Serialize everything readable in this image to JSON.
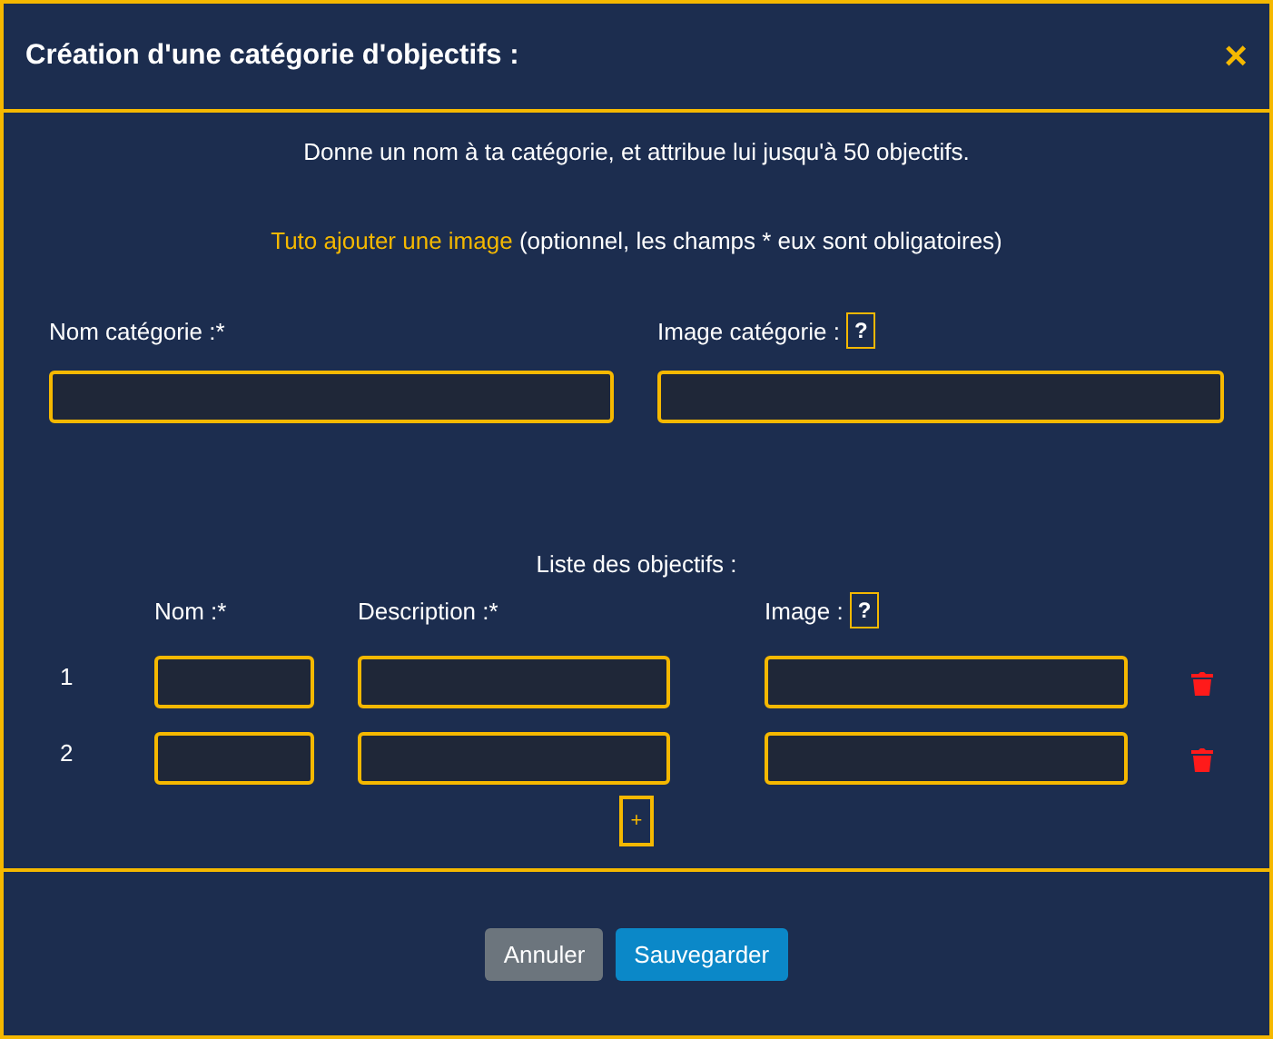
{
  "modal": {
    "title": "Création d'une catégorie d'objectifs :",
    "close": "×"
  },
  "intro": "Donne un nom à ta catégorie, et attribue lui jusqu'à 50 objectifs.",
  "tutorial": {
    "link": "Tuto ajouter une image",
    "note": "(optionnel, les champs * eux sont obligatoires)"
  },
  "category_fields": [
    {
      "label": "Nom catégorie :*"
    },
    {
      "label": "Image catégorie :",
      "help": "?"
    }
  ],
  "objectives": {
    "title": "Liste des objectifs :",
    "columns": [
      {
        "label": "Nom :*"
      },
      {
        "label": "Description :*"
      },
      {
        "label": "Image :",
        "help": "?"
      }
    ],
    "rows": [
      {
        "number": "1"
      },
      {
        "number": "2"
      }
    ],
    "add": "+"
  },
  "buttons": [
    {
      "label": "Annuler",
      "kind": "secondary"
    },
    {
      "label": "Sauvegarder",
      "kind": "primary"
    }
  ]
}
